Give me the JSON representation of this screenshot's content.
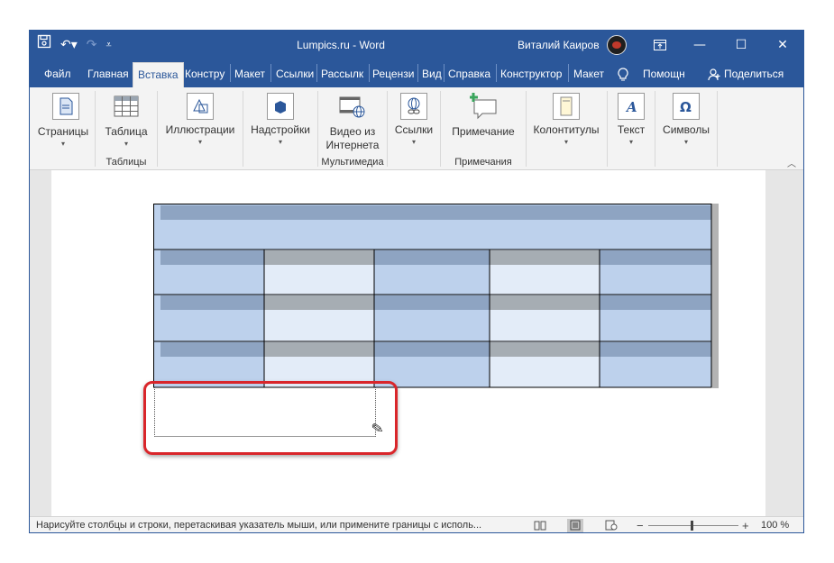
{
  "window": {
    "title": "Lumpics.ru  -  Word",
    "user": "Виталий Каиров",
    "accent": "#2b579a"
  },
  "qat": {
    "save_icon": "save-icon",
    "undo_icon": "undo-icon",
    "redo_icon": "redo-icon",
    "customize_icon": "customize-qat-icon"
  },
  "tabs": [
    {
      "label": "Файл"
    },
    {
      "label": "Главная"
    },
    {
      "label": "Вставка",
      "active": true
    },
    {
      "label": "Констру"
    },
    {
      "label": "Макет"
    },
    {
      "label": "Ссылки"
    },
    {
      "label": "Рассылк"
    },
    {
      "label": "Рецензи"
    },
    {
      "label": "Вид"
    },
    {
      "label": "Справка"
    },
    {
      "label": "Конструктор"
    },
    {
      "label": "Макет"
    },
    {
      "label": "Помощн"
    },
    {
      "label": "Поделиться"
    }
  ],
  "ribbon": {
    "pages": {
      "label": "Страницы"
    },
    "table": {
      "label": "Таблица",
      "group": "Таблицы"
    },
    "illustrations": {
      "label": "Иллюстрации"
    },
    "addins": {
      "label": "Надстройки"
    },
    "video": {
      "label1": "Видео из",
      "label2": "Интернета",
      "group": "Мультимедиа"
    },
    "links": {
      "label": "Ссылки"
    },
    "comment": {
      "label": "Примечание",
      "group": "Примечания"
    },
    "headers": {
      "label": "Колонтитулы"
    },
    "text": {
      "label": "Текст"
    },
    "symbols": {
      "label": "Символы"
    }
  },
  "status": {
    "text": "Нарисуйте столбцы и строки, перетаскивая указатель мыши, или примените границы с исполь...",
    "zoom_minus": "−",
    "zoom_plus": "+",
    "zoom": "100 %",
    "zoom_level_percent": 100
  },
  "colors": {
    "table_dark": "#8ea4c2",
    "table_light": "#bdd1ec",
    "table_gray": "#a6adb3",
    "table_pale": "#e3ecf8",
    "highlight": "#d9262b"
  }
}
